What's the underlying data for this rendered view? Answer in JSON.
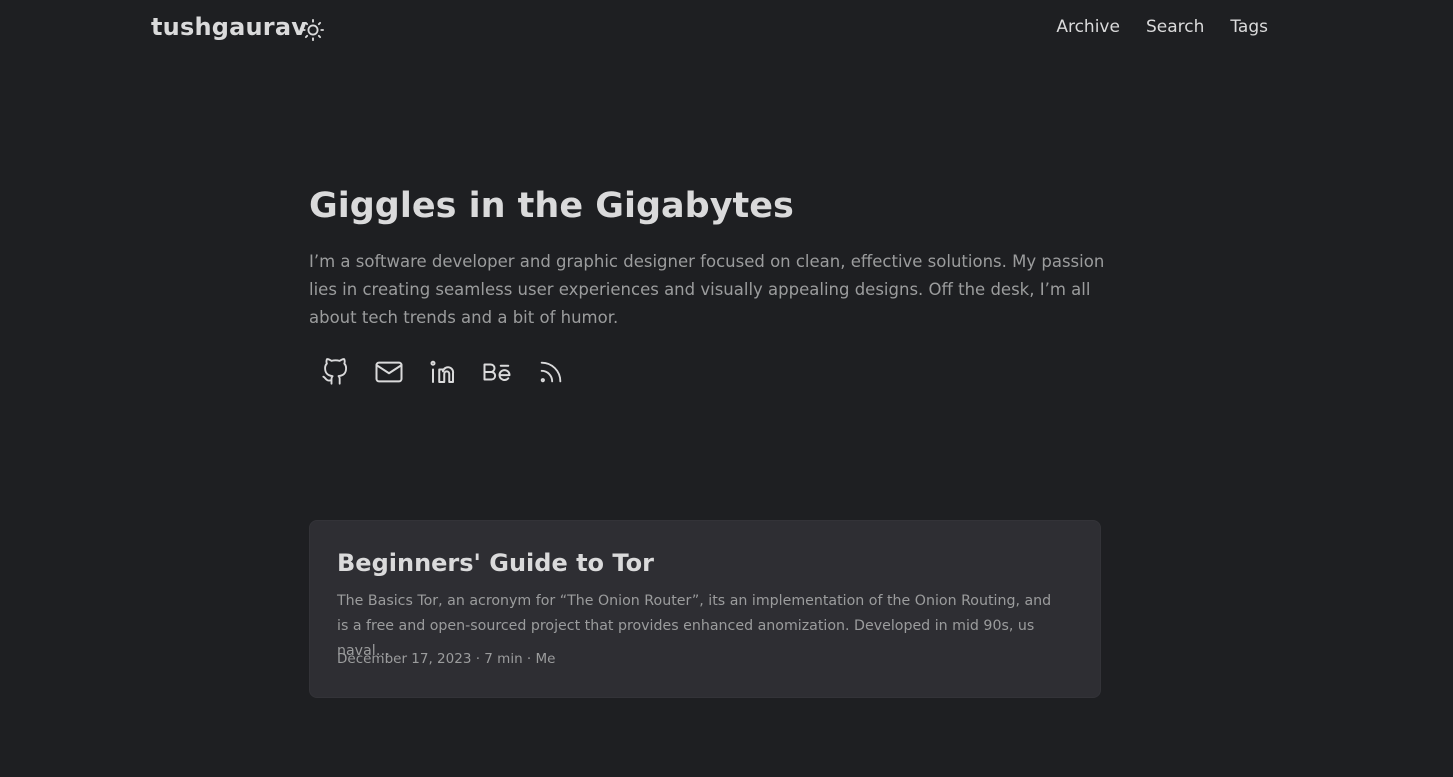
{
  "header": {
    "logo": "tushgaurav",
    "theme_toggle_icon": "sun-icon",
    "nav": [
      {
        "label": "Archive"
      },
      {
        "label": "Search"
      },
      {
        "label": "Tags"
      }
    ]
  },
  "home": {
    "title": "Giggles in the Gigabytes",
    "description": "I’m a software developer and graphic designer focused on clean, effective solutions. My passion lies in creating seamless user experiences and visually appealing designs. Off the desk, I’m all about tech trends and a bit of humor.",
    "social_icons": [
      "github-icon",
      "email-icon",
      "linkedin-icon",
      "behance-icon",
      "rss-icon"
    ]
  },
  "posts": [
    {
      "title": "Beginners' Guide to Tor",
      "summary": "The Basics Tor, an acronym for “The Onion Router”, its an implementation of the Onion Routing, and is a free and open-sourced project that provides enhanced anomization. Developed in mid 90s, us naval…",
      "meta": "December 17, 2023 · 7 min · Me"
    }
  ],
  "colors": {
    "background": "#1e1f22",
    "card": "#2e2e33",
    "primary_text": "#dadadb",
    "secondary_text": "#9b9c9d"
  }
}
